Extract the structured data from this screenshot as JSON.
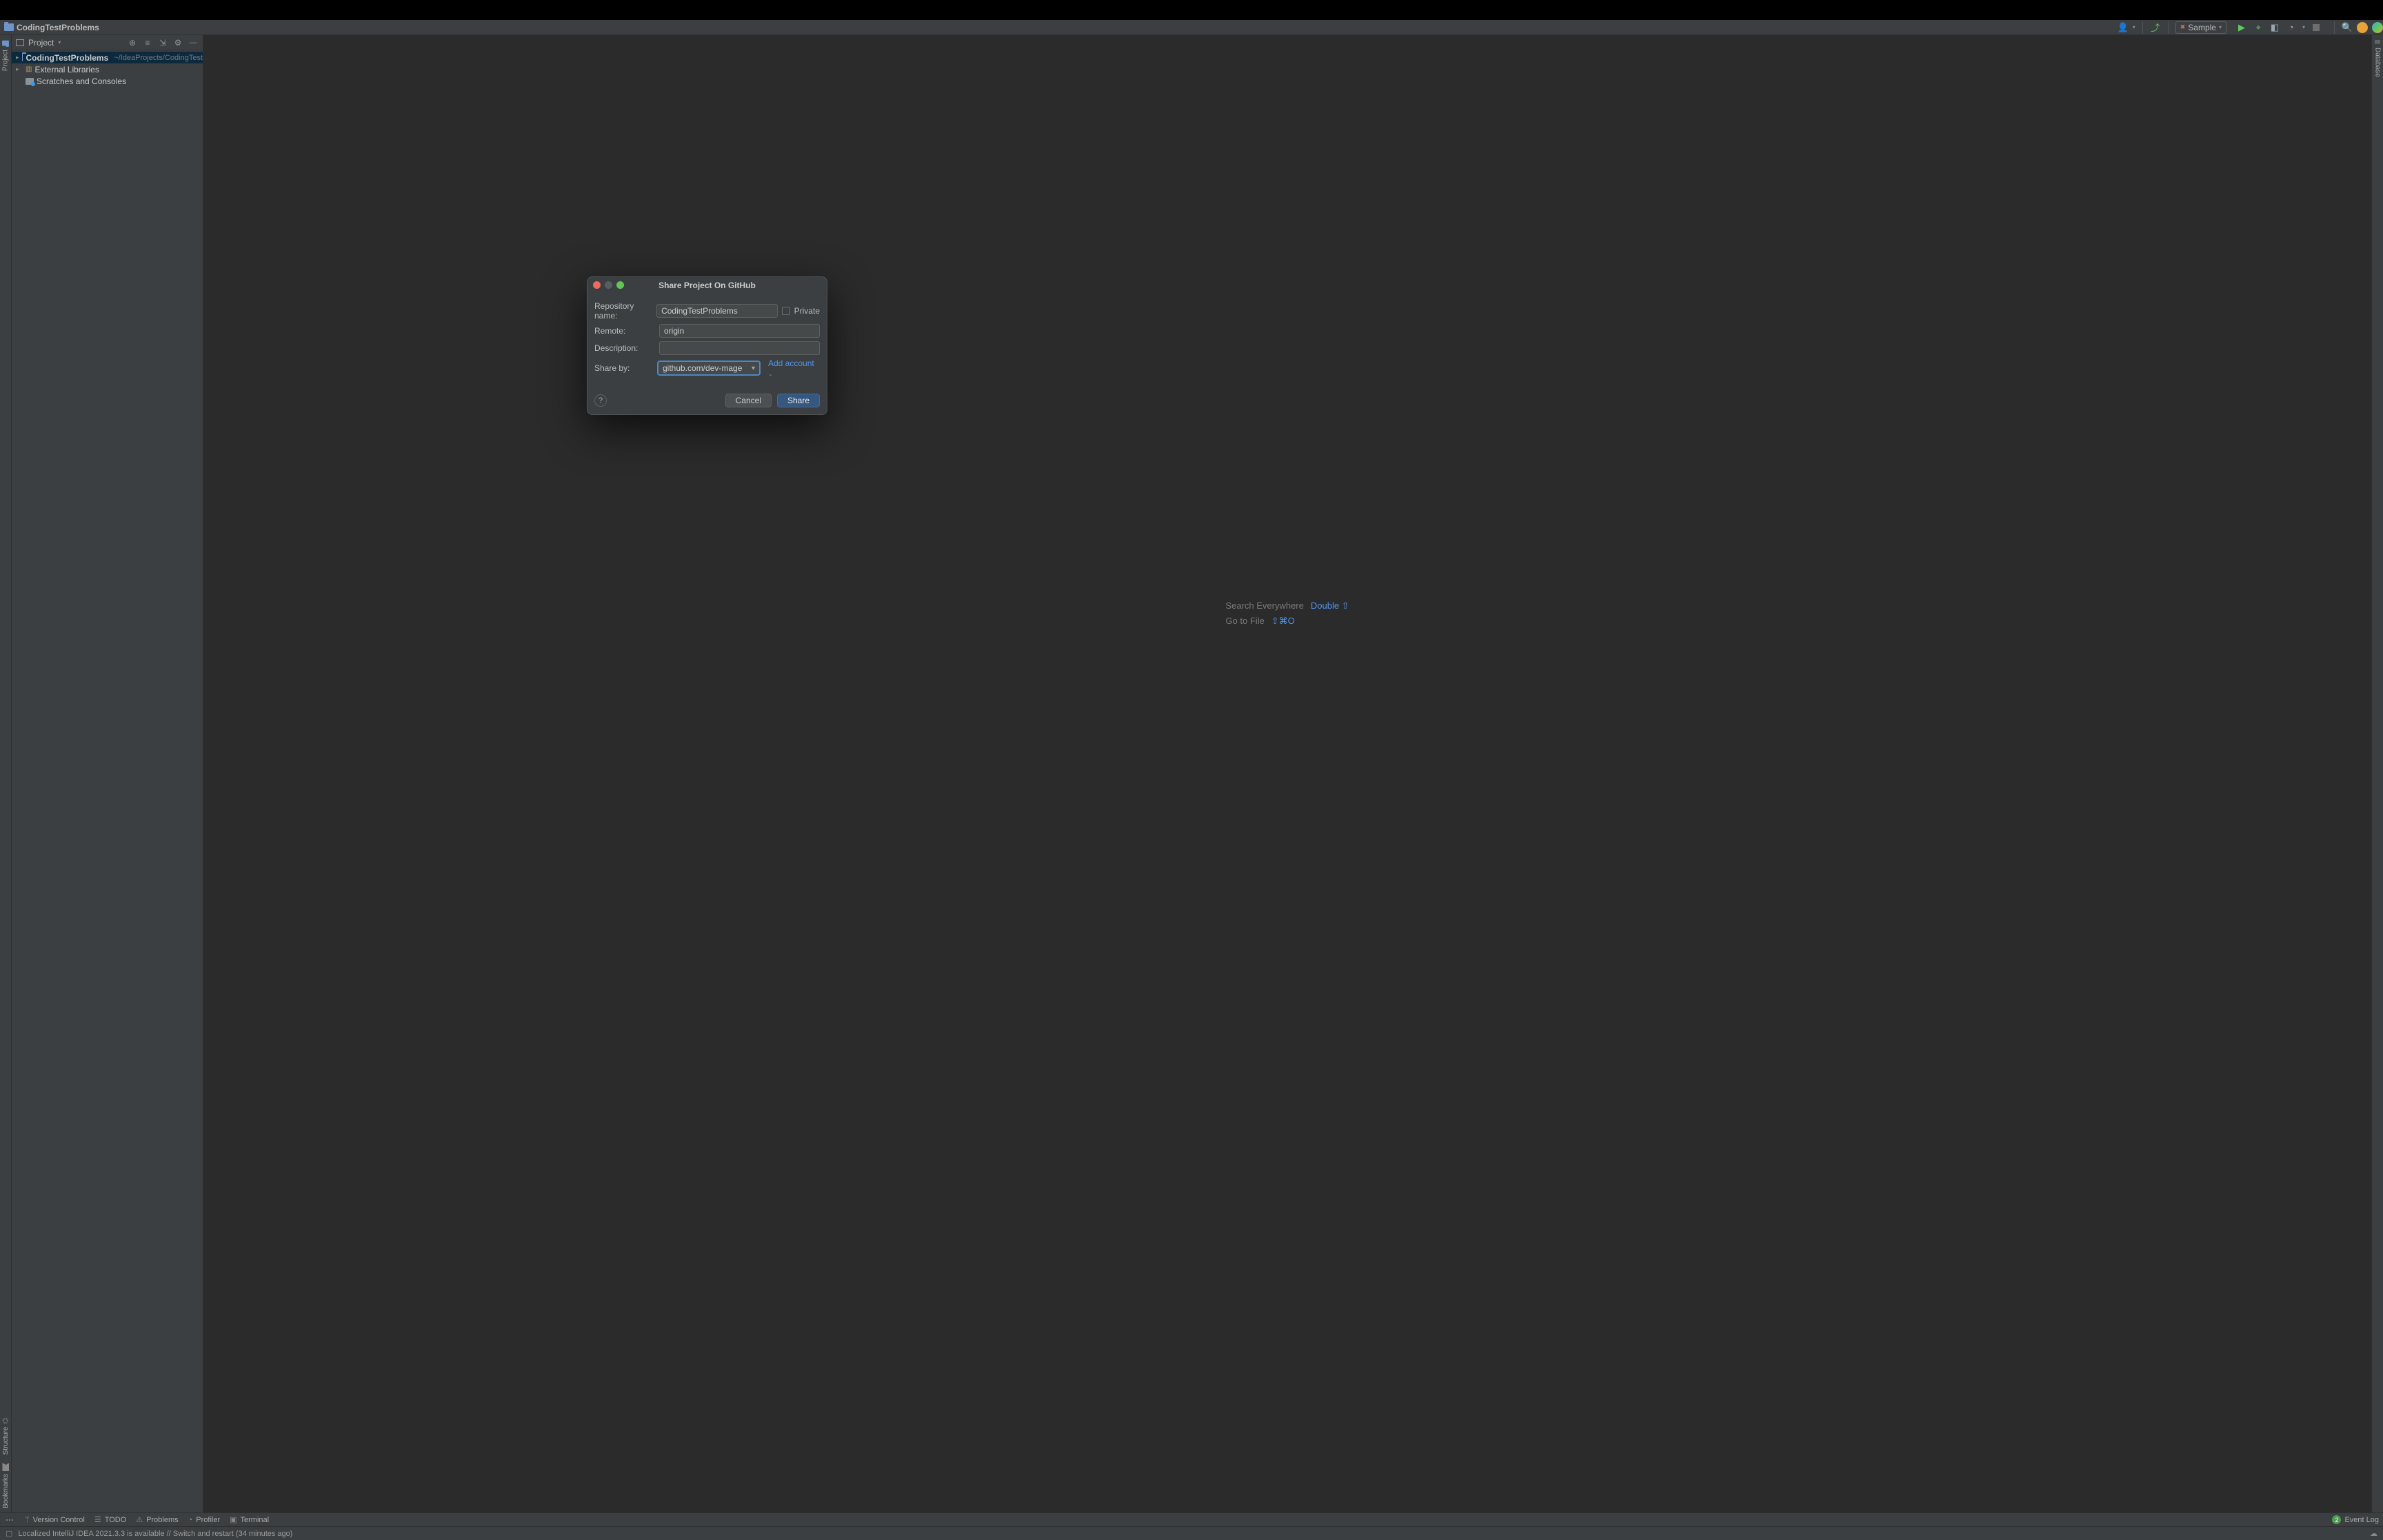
{
  "breadcrumb": {
    "project": "CodingTestProblems"
  },
  "run_config": {
    "name": "Sample"
  },
  "gutter": {
    "left_top": "Project",
    "left_bottom1": "Structure",
    "left_bottom2": "Bookmarks",
    "right": "Database"
  },
  "project_panel": {
    "title": "Project",
    "tree": {
      "root_name": "CodingTestProblems",
      "root_path": "~/IdeaProjects/CodingTest",
      "libs": "External Libraries",
      "scratches": "Scratches and Consoles"
    }
  },
  "welcome": {
    "line1_label": "Search Everywhere",
    "line1_short": "Double ⇧",
    "line2_label": "Go to File",
    "line2_short": "⇧⌘O"
  },
  "dialog": {
    "title": "Share Project On GitHub",
    "repo_label": "Repository name:",
    "repo_value": "CodingTestProblems",
    "private_label": "Private",
    "remote_label": "Remote:",
    "remote_value": "origin",
    "desc_label": "Description:",
    "desc_value": "",
    "shareby_label": "Share by:",
    "shareby_value": "github.com/dev-mage",
    "add_account": "Add account",
    "help": "?",
    "cancel": "Cancel",
    "share": "Share"
  },
  "bottom": {
    "vcs": "Version Control",
    "todo": "TODO",
    "problems": "Problems",
    "profiler": "Profiler",
    "terminal": "Terminal",
    "eventlog": "Event Log",
    "event_count": "2"
  },
  "status": {
    "msg": "Localized IntelliJ IDEA 2021.3.3 is available // Switch and restart (34 minutes ago)"
  }
}
